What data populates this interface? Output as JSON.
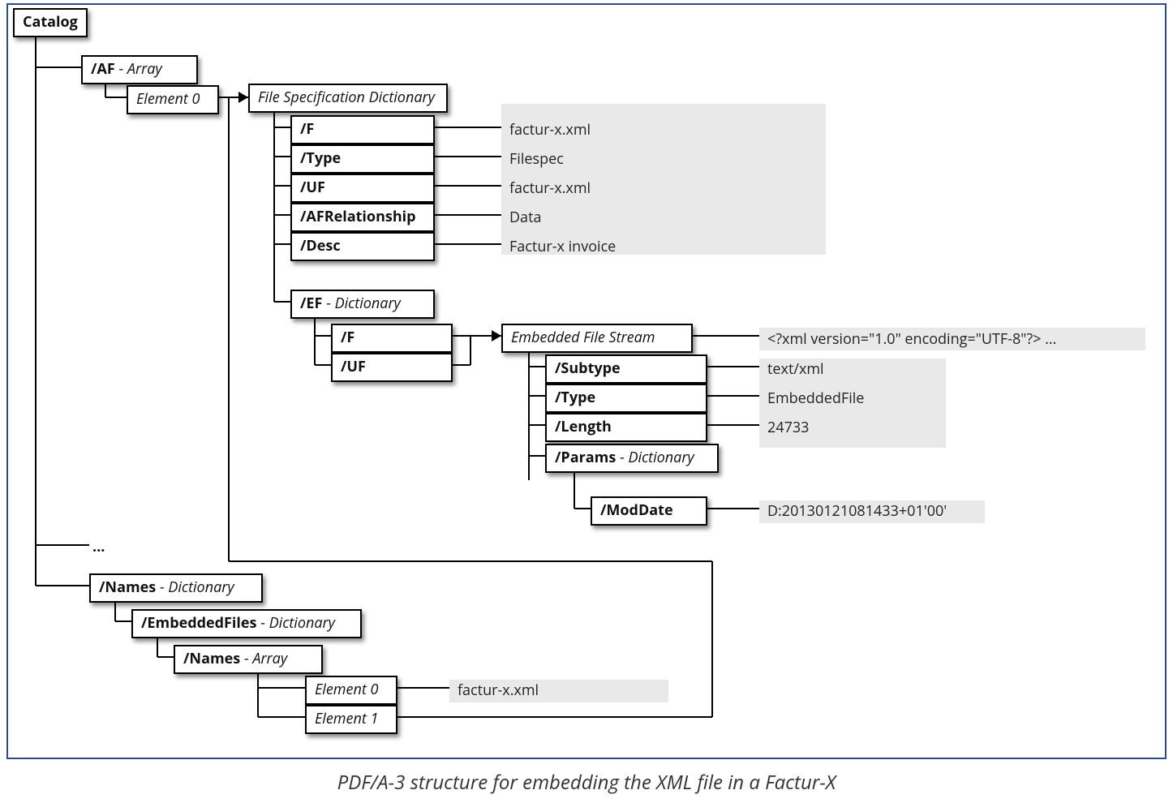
{
  "caption": "PDF/A-3 structure for embedding the XML file in a Factur-X",
  "catalog": {
    "label": "Catalog",
    "ellipsis": "...",
    "af": {
      "key": "/AF",
      "type": "Array",
      "element0": {
        "label": "Element 0",
        "filespec": {
          "header": "File Specification Dictionary",
          "f": {
            "key": "/F",
            "value": "factur-x.xml"
          },
          "type": {
            "key": "/Type",
            "value": "Filespec"
          },
          "uf": {
            "key": "/UF",
            "value": "factur-x.xml"
          },
          "afr": {
            "key": "/AFRelationship",
            "value": "Data"
          },
          "desc": {
            "key": "/Desc",
            "value": "Factur-x invoice"
          },
          "ef": {
            "key": "/EF",
            "type": "Dictionary",
            "f": {
              "key": "/F"
            },
            "uf": {
              "key": "/UF"
            },
            "stream": {
              "header": "Embedded File Stream",
              "preview": "<?xml version=\"1.0\" encoding=\"UTF-8\"?> ...",
              "subtype": {
                "key": "/Subtype",
                "value": "text/xml"
              },
              "type": {
                "key": "/Type",
                "value": "EmbeddedFile"
              },
              "length": {
                "key": "/Length",
                "value": "24733"
              },
              "params": {
                "key": "/Params",
                "type": "Dictionary"
              },
              "moddate": {
                "key": "/ModDate",
                "value": "D:20130121081433+01'00'"
              }
            }
          }
        }
      }
    },
    "names": {
      "key": "/Names",
      "type": "Dictionary",
      "embeddedfiles": {
        "key": "/EmbeddedFiles",
        "type": "Dictionary",
        "names2": {
          "key": "/Names",
          "type": "Array",
          "element0": {
            "label": "Element 0",
            "value": "factur-x.xml"
          },
          "element1": {
            "label": "Element 1"
          }
        }
      }
    }
  }
}
